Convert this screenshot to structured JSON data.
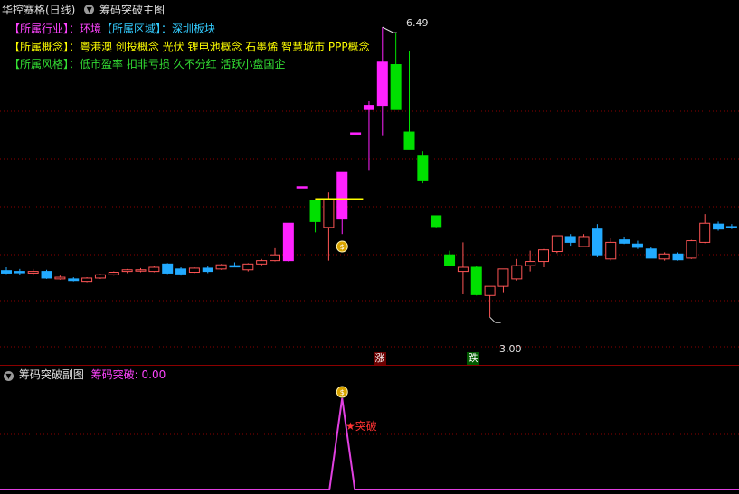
{
  "main_panel": {
    "stock_name": "华控赛格(日线)",
    "indicator_title": "筹码突破主图",
    "industry": {
      "label": "【所属行业】：",
      "value": "环境",
      "region_label": "【所属区域】：",
      "region_value": "深圳板块"
    },
    "concept": {
      "label": "【所属概念】：",
      "value": "粤港澳 创投概念 光伏 锂电池概念 石墨烯 智慧城市 PPP概念"
    },
    "style": {
      "label": "【所属风格】：",
      "value": "低市盈率 扣非亏损 久不分红 活跃小盘国企"
    },
    "high_label": "6.49",
    "low_label": "3.00",
    "limit_up_mark": "涨",
    "limit_down_mark": "跌"
  },
  "sub_panel": {
    "indicator_title": "筹码突破副图",
    "value_label": "筹码突破: 0.00",
    "signal_text": "突破"
  },
  "colors": {
    "up": "#ff5555",
    "down": "#00e000",
    "cyan": "#22aaff",
    "magenta": "#ff22ff",
    "yellow_line": "#ffff00",
    "grid": "#8b0000",
    "sub_line": "#e040e0"
  },
  "icons": {
    "collapse": "chevron-down-icon",
    "signal": "money-bag-icon",
    "star": "star-icon"
  },
  "chart_data": {
    "type": "candlestick",
    "ylim": [
      2.6,
      6.6
    ],
    "high_marker": 6.49,
    "low_marker": 3.0,
    "signal_index": 24,
    "candles": [
      {
        "o": 3.56,
        "h": 3.6,
        "l": 3.52,
        "c": 3.53,
        "k": "cyan"
      },
      {
        "o": 3.54,
        "h": 3.58,
        "l": 3.51,
        "c": 3.55,
        "k": "cyan"
      },
      {
        "o": 3.53,
        "h": 3.58,
        "l": 3.5,
        "c": 3.55,
        "k": "up"
      },
      {
        "o": 3.55,
        "h": 3.57,
        "l": 3.46,
        "c": 3.47,
        "k": "cyan"
      },
      {
        "o": 3.48,
        "h": 3.5,
        "l": 3.45,
        "c": 3.46,
        "k": "up"
      },
      {
        "o": 3.46,
        "h": 3.48,
        "l": 3.43,
        "c": 3.44,
        "k": "cyan"
      },
      {
        "o": 3.43,
        "h": 3.48,
        "l": 3.42,
        "c": 3.47,
        "k": "up"
      },
      {
        "o": 3.47,
        "h": 3.52,
        "l": 3.46,
        "c": 3.51,
        "k": "up"
      },
      {
        "o": 3.51,
        "h": 3.55,
        "l": 3.5,
        "c": 3.54,
        "k": "up"
      },
      {
        "o": 3.55,
        "h": 3.58,
        "l": 3.53,
        "c": 3.57,
        "k": "up"
      },
      {
        "o": 3.56,
        "h": 3.59,
        "l": 3.54,
        "c": 3.57,
        "k": "up"
      },
      {
        "o": 3.55,
        "h": 3.62,
        "l": 3.54,
        "c": 3.6,
        "k": "up"
      },
      {
        "o": 3.64,
        "h": 3.65,
        "l": 3.52,
        "c": 3.53,
        "k": "cyan"
      },
      {
        "o": 3.58,
        "h": 3.6,
        "l": 3.5,
        "c": 3.52,
        "k": "cyan"
      },
      {
        "o": 3.54,
        "h": 3.6,
        "l": 3.53,
        "c": 3.59,
        "k": "up"
      },
      {
        "o": 3.59,
        "h": 3.62,
        "l": 3.53,
        "c": 3.55,
        "k": "cyan"
      },
      {
        "o": 3.58,
        "h": 3.64,
        "l": 3.57,
        "c": 3.63,
        "k": "up"
      },
      {
        "o": 3.62,
        "h": 3.66,
        "l": 3.6,
        "c": 3.62,
        "k": "cyan"
      },
      {
        "o": 3.57,
        "h": 3.65,
        "l": 3.55,
        "c": 3.64,
        "k": "up"
      },
      {
        "o": 3.64,
        "h": 3.7,
        "l": 3.62,
        "c": 3.68,
        "k": "up"
      },
      {
        "o": 3.68,
        "h": 3.83,
        "l": 3.67,
        "c": 3.75,
        "k": "up"
      },
      {
        "o": 3.68,
        "h": 4.13,
        "l": 3.67,
        "c": 4.13,
        "k": "magenta"
      },
      {
        "o": 4.57,
        "h": 4.57,
        "l": 4.57,
        "c": 4.57,
        "k": "magenta"
      },
      {
        "o": 4.15,
        "h": 4.4,
        "l": 4.02,
        "c": 4.4,
        "k": "down"
      },
      {
        "o": 4.42,
        "h": 4.5,
        "l": 3.68,
        "c": 4.08,
        "k": "up"
      },
      {
        "o": 4.18,
        "h": 4.75,
        "l": 4.0,
        "c": 4.75,
        "k": "magenta"
      },
      {
        "o": 5.22,
        "h": 5.22,
        "l": 5.22,
        "c": 5.22,
        "k": "magenta"
      },
      {
        "o": 5.5,
        "h": 5.6,
        "l": 4.77,
        "c": 5.55,
        "k": "magenta"
      },
      {
        "o": 5.55,
        "h": 6.49,
        "l": 5.18,
        "c": 6.07,
        "k": "magenta"
      },
      {
        "o": 6.04,
        "h": 6.42,
        "l": 5.5,
        "c": 5.5,
        "k": "down"
      },
      {
        "o": 5.23,
        "h": 6.2,
        "l": 5.02,
        "c": 5.02,
        "k": "down"
      },
      {
        "o": 4.94,
        "h": 5.0,
        "l": 4.61,
        "c": 4.65,
        "k": "down"
      },
      {
        "o": 4.22,
        "h": 4.22,
        "l": 4.08,
        "c": 4.09,
        "k": "down"
      },
      {
        "o": 3.75,
        "h": 3.8,
        "l": 3.62,
        "c": 3.62,
        "k": "down"
      },
      {
        "o": 3.55,
        "h": 3.9,
        "l": 3.28,
        "c": 3.6,
        "k": "up"
      },
      {
        "o": 3.6,
        "h": 3.62,
        "l": 3.26,
        "c": 3.27,
        "k": "down"
      },
      {
        "o": 3.26,
        "h": 3.34,
        "l": 3.0,
        "c": 3.37,
        "k": "up"
      },
      {
        "o": 3.37,
        "h": 3.58,
        "l": 3.3,
        "c": 3.58,
        "k": "up"
      },
      {
        "o": 3.46,
        "h": 3.7,
        "l": 3.44,
        "c": 3.62,
        "k": "up"
      },
      {
        "o": 3.62,
        "h": 3.8,
        "l": 3.55,
        "c": 3.67,
        "k": "up"
      },
      {
        "o": 3.67,
        "h": 3.82,
        "l": 3.6,
        "c": 3.81,
        "k": "up"
      },
      {
        "o": 3.79,
        "h": 3.98,
        "l": 3.77,
        "c": 3.98,
        "k": "up"
      },
      {
        "o": 3.97,
        "h": 4.0,
        "l": 3.86,
        "c": 3.9,
        "k": "cyan"
      },
      {
        "o": 3.85,
        "h": 4.0,
        "l": 3.84,
        "c": 3.97,
        "k": "up"
      },
      {
        "o": 4.06,
        "h": 4.12,
        "l": 3.72,
        "c": 3.75,
        "k": "cyan"
      },
      {
        "o": 3.7,
        "h": 3.95,
        "l": 3.68,
        "c": 3.9,
        "k": "up"
      },
      {
        "o": 3.93,
        "h": 3.97,
        "l": 3.88,
        "c": 3.89,
        "k": "cyan"
      },
      {
        "o": 3.88,
        "h": 3.92,
        "l": 3.82,
        "c": 3.84,
        "k": "cyan"
      },
      {
        "o": 3.82,
        "h": 3.85,
        "l": 3.71,
        "c": 3.71,
        "k": "cyan"
      },
      {
        "o": 3.76,
        "h": 3.78,
        "l": 3.68,
        "c": 3.7,
        "k": "up"
      },
      {
        "o": 3.69,
        "h": 3.78,
        "l": 3.68,
        "c": 3.76,
        "k": "cyan"
      },
      {
        "o": 3.71,
        "h": 3.93,
        "l": 3.7,
        "c": 3.92,
        "k": "up"
      },
      {
        "o": 3.9,
        "h": 4.24,
        "l": 3.89,
        "c": 4.13,
        "k": "up"
      },
      {
        "o": 4.12,
        "h": 4.15,
        "l": 4.04,
        "c": 4.06,
        "k": "cyan"
      },
      {
        "o": 4.08,
        "h": 4.12,
        "l": 4.06,
        "c": 4.09,
        "k": "cyan"
      }
    ],
    "indicator": {
      "values": "0 except a spike at the signal bar",
      "ylim": [
        0,
        1
      ]
    }
  }
}
